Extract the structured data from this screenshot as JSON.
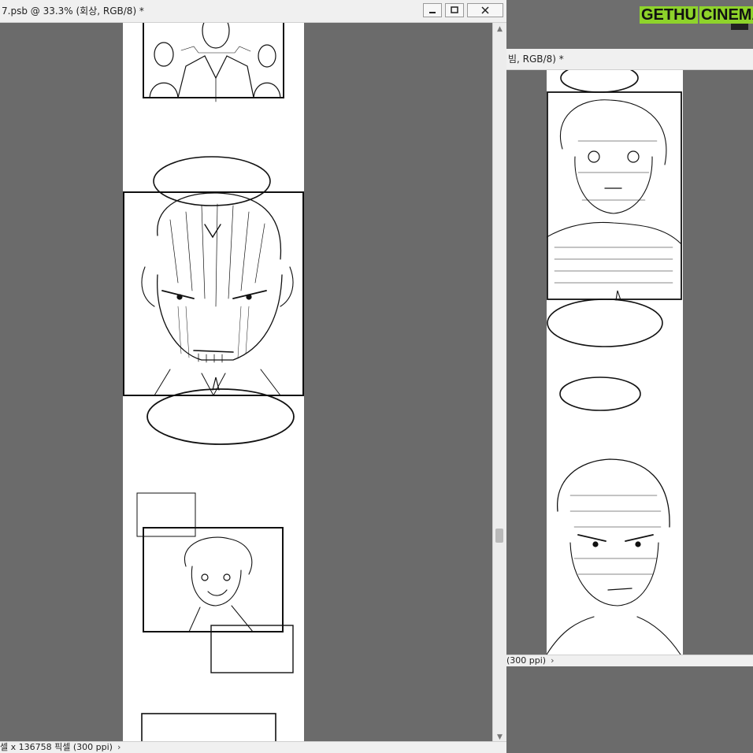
{
  "left_window": {
    "title": "7.psb @ 33.3% (회상, RGB/8) *",
    "status": "셀 x 136758 픽셀 (300 ppi)",
    "buttons": {
      "minimize": "minimize",
      "maximize": "maximize",
      "close": "close"
    }
  },
  "right_window": {
    "title": "빔, RGB/8) *",
    "status": "(300 ppi)"
  },
  "watermark": {
    "part1": "GETHU",
    "part2": "CINEMA"
  },
  "colors": {
    "workspace": "#6b6b6b",
    "chrome": "#f0f0f0",
    "watermark_green": "#8ed32b"
  }
}
